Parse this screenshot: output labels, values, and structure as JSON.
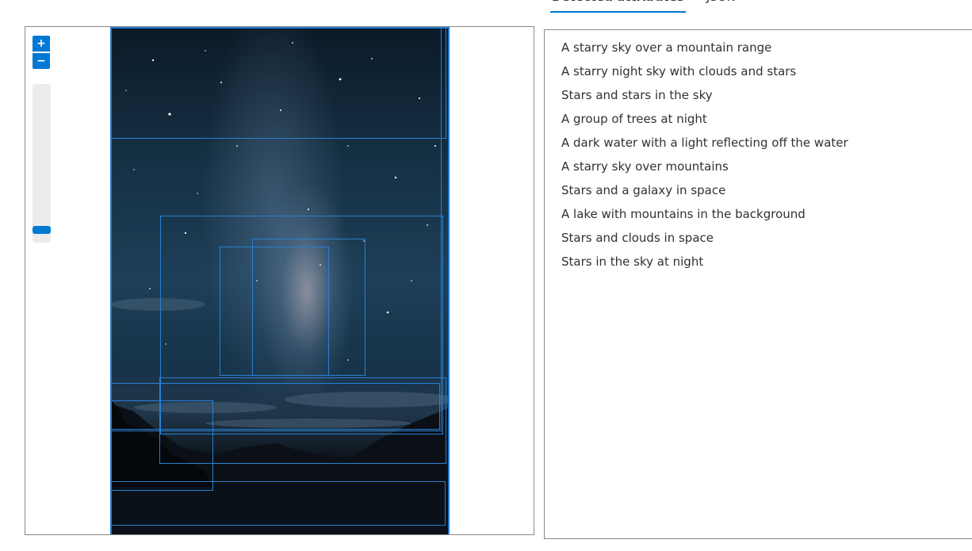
{
  "tabs": {
    "detected": "Detected attributes",
    "json": "JSON"
  },
  "viewer": {
    "zoom_in": "+",
    "zoom_out": "−",
    "zoom_level": 0.1,
    "image_description": "starry-night-photo"
  },
  "attributes": [
    "A starry sky over a mountain range",
    "A starry night sky with clouds and stars",
    "Stars and stars in the sky",
    "A group of trees at night",
    "A dark water with a light reflecting off the water",
    "A starry sky over mountains",
    "Stars and a galaxy in space",
    "A lake with mountains in the background",
    "Stars and clouds in space",
    "Stars in the sky at night"
  ],
  "colors": {
    "accent": "#0078d4",
    "border": "#8a8886",
    "text": "#323130",
    "bbox": "#2a7fd4"
  }
}
